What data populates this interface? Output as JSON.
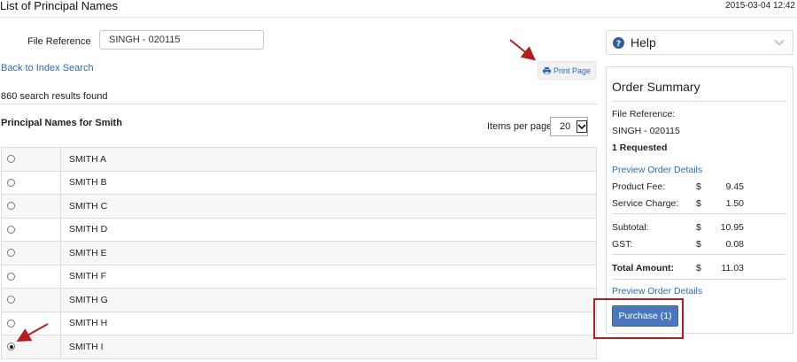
{
  "header": {
    "title": "List of Principal Names",
    "datetime": "2015-03-04 12:42"
  },
  "form": {
    "file_reference_label": "File Reference",
    "file_reference_value": "SINGH - 020115"
  },
  "nav": {
    "back_link": "Back to Index Search"
  },
  "toolbar": {
    "print_label": "Print Page",
    "print_icon": "printer-icon"
  },
  "results": {
    "count_text": "860 search results found",
    "heading": "Principal Names for Smith",
    "items_per_page_label": "Items per page",
    "items_per_page_value": "20"
  },
  "rows": [
    {
      "name": "SMITH A",
      "selected": false
    },
    {
      "name": "SMITH B",
      "selected": false
    },
    {
      "name": "SMITH C",
      "selected": false
    },
    {
      "name": "SMITH D",
      "selected": false
    },
    {
      "name": "SMITH E",
      "selected": false
    },
    {
      "name": "SMITH F",
      "selected": false
    },
    {
      "name": "SMITH G",
      "selected": false
    },
    {
      "name": "SMITH H",
      "selected": false
    },
    {
      "name": "SMITH I",
      "selected": true
    }
  ],
  "help": {
    "label": "Help",
    "icon": "question-circle-icon"
  },
  "order": {
    "title": "Order Summary",
    "file_reference_label": "File Reference:",
    "file_reference_value": "SINGH - 020115",
    "requested": "1 Requested",
    "preview_link": "Preview Order Details",
    "product_fee_label": "Product Fee:",
    "product_fee_currency": "$",
    "product_fee_amount": "9.45",
    "service_charge_label": "Service Charge:",
    "service_charge_currency": "$",
    "service_charge_amount": "1.50",
    "subtotal_label": "Subtotal:",
    "subtotal_currency": "$",
    "subtotal_amount": "10.95",
    "gst_label": "GST:",
    "gst_currency": "$",
    "gst_amount": "0.08",
    "total_label": "Total Amount:",
    "total_currency": "$",
    "total_amount": "11.03",
    "preview_link_2": "Preview Order Details",
    "purchase_label": "Purchase (1)"
  },
  "colors": {
    "link": "#2d6ab4",
    "primary_button": "#4b78bd",
    "highlight": "#b51e1e"
  }
}
